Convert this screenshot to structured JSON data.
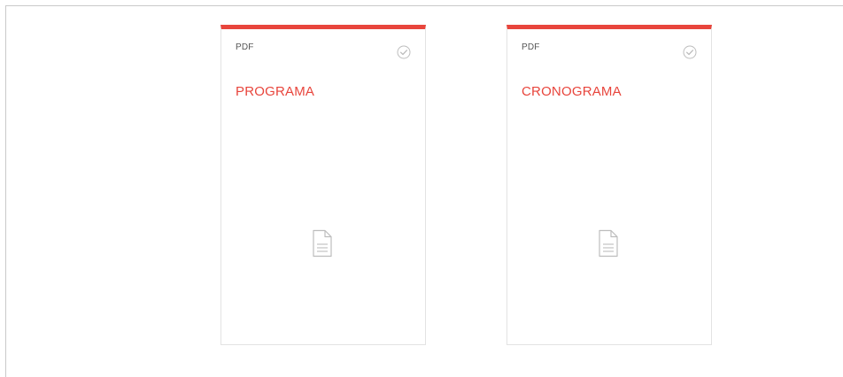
{
  "cards": [
    {
      "type_label": "PDF",
      "title": "PROGRAMA",
      "status_icon": "check-circle-icon",
      "file_icon": "document-icon"
    },
    {
      "type_label": "PDF",
      "title": "CRONOGRAMA",
      "status_icon": "check-circle-icon",
      "file_icon": "document-icon"
    }
  ],
  "colors": {
    "accent": "#e8453c",
    "card_border": "#e3e3e3",
    "icon_gray": "#bdbdbd"
  }
}
